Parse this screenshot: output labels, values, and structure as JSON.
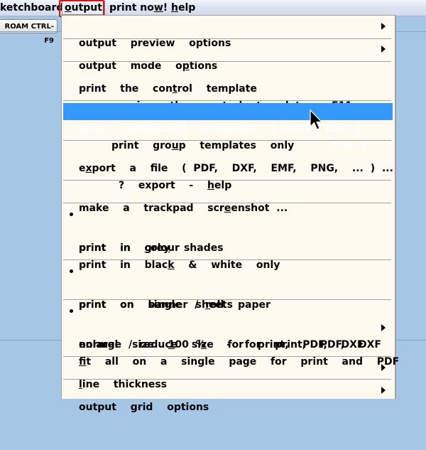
{
  "menubar": {
    "items": [
      {
        "pre": "",
        "u": "",
        "post": "ketchboard"
      },
      {
        "pre": "",
        "u": "o",
        "post": "utput"
      },
      {
        "pre": "print no",
        "u": "w",
        "post": "!"
      },
      {
        "pre": "",
        "u": "h",
        "post": "elp"
      }
    ]
  },
  "toolbar": {
    "roam_button": "ROAM  CTRL-F9"
  },
  "menu": {
    "items": [
      {
        "pre": "output  preview  options",
        "u": "",
        "post": "",
        "shortcut": "",
        "submenu": true
      },
      {
        "pre": "output  mode  o",
        "u": "p",
        "post": "tions",
        "shortcut": "",
        "submenu": true
      },
      {
        "pre": "print  the  con",
        "u": "t",
        "post": "rol  template",
        "shortcut": "F11"
      },
      {
        "pre": "pre",
        "u": "v",
        "post": "iew  the  control  template",
        "shortcut": ""
      },
      {
        "pre": "print  ",
        "u": "b",
        "post": "ackground  templates  ( track  plan )",
        "shortcut": "Ctrl+F11",
        "highlighted": true
      },
      {
        "pre": "print  gro",
        "u": "u",
        "post": "p  templates  only",
        "shortcut": ""
      },
      {
        "pre": "e",
        "u": "x",
        "post": "port  a  file  ( PDF,  DXF,  EMF,  PNG,  ... ) ...",
        "shortcut": ""
      },
      {
        "pre": "?  export  -  ",
        "u": "h",
        "post": "elp",
        "shortcut": ""
      },
      {
        "pre": "make  a  trackpad  scr",
        "u": "e",
        "post": "enshot ...",
        "shortcut": ""
      },
      {
        "pre": "print  in  ",
        "u": "c",
        "post": "olour",
        "checked": true
      },
      {
        "pre": "print  in  gre",
        "u": "y",
        "post": "  shades"
      },
      {
        "pre": "print  in  blac",
        "u": "k",
        "post": "  &  white  only"
      },
      {
        "pre": "print  on  single  sheets",
        "u": "",
        "post": "",
        "checked": true
      },
      {
        "pre": "print  on  banner / ",
        "u": "r",
        "post": "oll  paper"
      },
      {
        "pre": "normal  size  ",
        "u": "1",
        "post": "00 %   -  for  print,  PDF,  DXF",
        "checked": true
      },
      {
        "pre": "enlarge / reduce  si",
        "u": "z",
        "post": "e  for  print,  PDF,  DXF",
        "submenu": true
      },
      {
        "pre": "",
        "u": "f",
        "post": "it  all  on  a  single  page  for  print  and  PDF"
      },
      {
        "pre": "",
        "u": "l",
        "post": "ine  thickness",
        "submenu": true
      },
      {
        "pre": "output  grid  options",
        "u": "",
        "post": "",
        "submenu": true
      }
    ]
  },
  "colors": {
    "highlight": "#3399ff",
    "menu_bg": "#fffaf0",
    "desktop_bg": "#a6c6e6",
    "callout_red": "#e01010"
  }
}
